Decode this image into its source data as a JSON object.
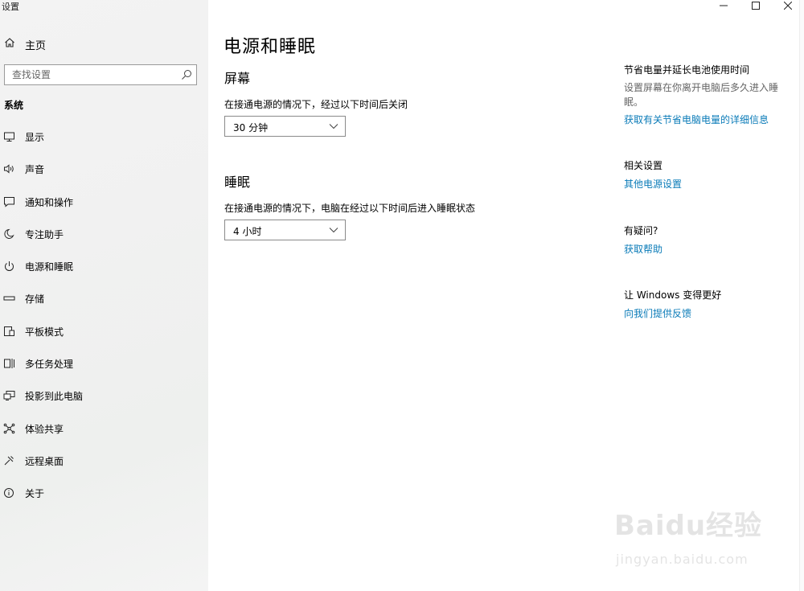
{
  "window": {
    "title": "设置"
  },
  "sidebar": {
    "home_label": "主页",
    "search_placeholder": "查找设置",
    "section_label": "系统",
    "items": [
      {
        "label": "显示",
        "icon": "monitor-icon"
      },
      {
        "label": "声音",
        "icon": "speaker-icon"
      },
      {
        "label": "通知和操作",
        "icon": "notification-icon"
      },
      {
        "label": "专注助手",
        "icon": "moon-icon"
      },
      {
        "label": "电源和睡眠",
        "icon": "power-icon",
        "active": true
      },
      {
        "label": "存储",
        "icon": "storage-icon"
      },
      {
        "label": "平板模式",
        "icon": "tablet-icon"
      },
      {
        "label": "多任务处理",
        "icon": "multitask-icon"
      },
      {
        "label": "投影到此电脑",
        "icon": "project-icon"
      },
      {
        "label": "体验共享",
        "icon": "share-icon"
      },
      {
        "label": "远程桌面",
        "icon": "remote-icon"
      },
      {
        "label": "关于",
        "icon": "info-icon"
      }
    ]
  },
  "main": {
    "title": "电源和睡眠",
    "screen": {
      "heading": "屏幕",
      "desc": "在接通电源的情况下，经过以下时间后关闭",
      "value": "30 分钟"
    },
    "sleep": {
      "heading": "睡眠",
      "desc": "在接通电源的情况下，电脑在经过以下时间后进入睡眠状态",
      "value": "4 小时"
    }
  },
  "right": {
    "battery": {
      "heading": "节省电量并延长电池使用时间",
      "text": "设置屏幕在你离开电脑后多久进入睡眠。",
      "link": "获取有关节省电脑电量的详细信息"
    },
    "related": {
      "heading": "相关设置",
      "link": "其他电源设置"
    },
    "question": {
      "heading": "有疑问?",
      "link": "获取帮助"
    },
    "feedback": {
      "heading": "让 Windows 变得更好",
      "link": "向我们提供反馈"
    }
  },
  "watermark": {
    "text": "Baidu经验",
    "sub": "jingyan.baidu.com"
  },
  "colors": {
    "link": "#0a7bb8",
    "sidebar_bg": "#f2f2f2"
  }
}
